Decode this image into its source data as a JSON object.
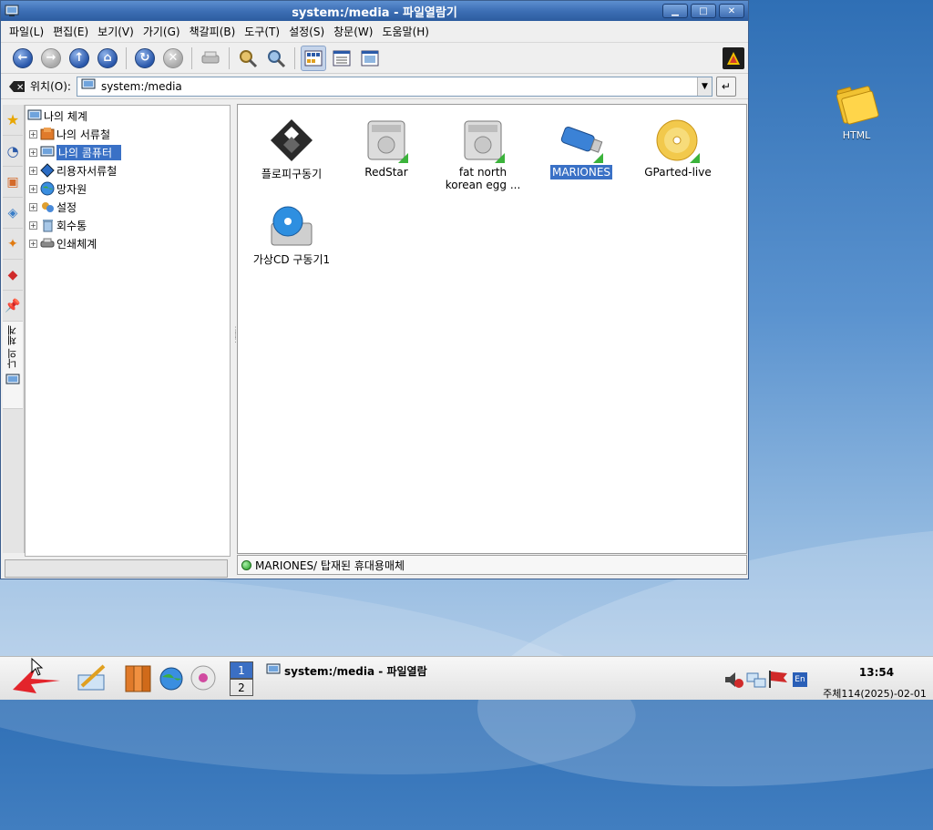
{
  "window": {
    "title": "system:/media - 파일열람기"
  },
  "menu": [
    "파일(L)",
    "편집(E)",
    "보기(V)",
    "가기(G)",
    "책갈피(B)",
    "도구(T)",
    "설정(S)",
    "창문(W)",
    "도움말(H)"
  ],
  "location": {
    "label": "위치(O):",
    "value": "system:/media"
  },
  "sidebar": {
    "vertical_tab_label": "나의 체계"
  },
  "tree": {
    "root": "나의 체계",
    "items": [
      "나의 서류철",
      "나의 콤퓨터",
      "리용자서류철",
      "망자원",
      "설정",
      "회수통",
      "인쇄체계"
    ],
    "selected_index": 1
  },
  "files": [
    {
      "label": "플로피구동기",
      "icon": "floppy-icon"
    },
    {
      "label": "RedStar",
      "icon": "hard-drive-icon"
    },
    {
      "label": "fat north korean egg ...",
      "icon": "hard-drive-icon"
    },
    {
      "label": "MARIONES",
      "icon": "usb-stick-icon"
    },
    {
      "label": "GParted-live",
      "icon": "cdrom-icon"
    },
    {
      "label": "가상CD 구동기1",
      "icon": "virtual-cd-drive-icon"
    }
  ],
  "status": {
    "text": "MARIONES/  탑재된 휴대용매체"
  },
  "desktop": {
    "icon_label": "HTML"
  },
  "taskbar": {
    "pager": [
      "1",
      "2"
    ],
    "task_label": "system:/media - 파일열람",
    "clock": "13:54",
    "date": "주체114(2025)-02-01",
    "lang": "En"
  },
  "colors": {
    "titlebar": "#3d6fb5",
    "selection": "#3a71c6",
    "desktop": "#5b93cf"
  }
}
